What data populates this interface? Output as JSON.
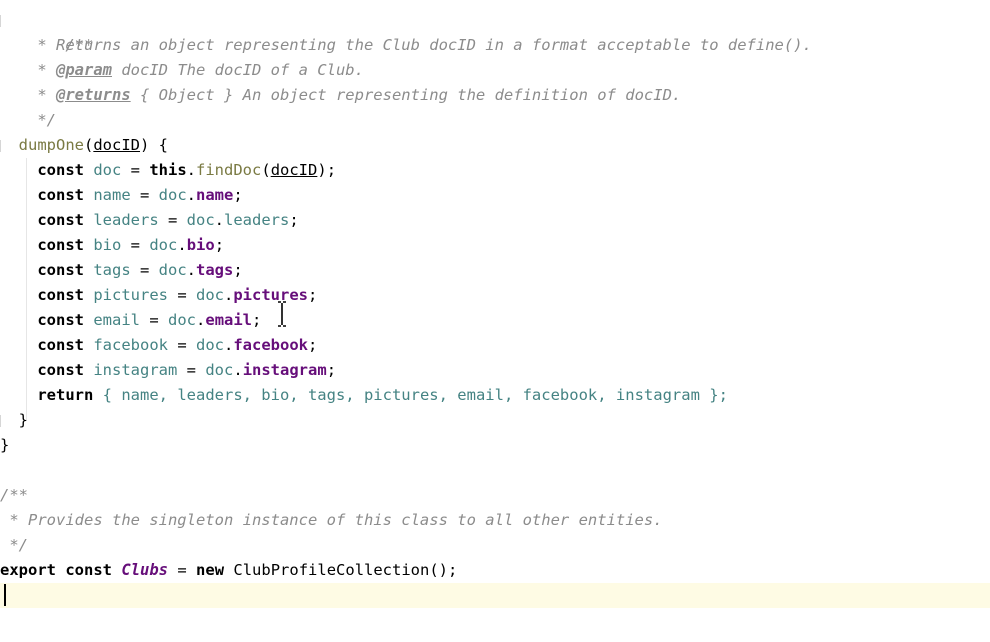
{
  "editor": {
    "language": "javascript",
    "doc_comment_1": {
      "open": "/**",
      "line1": " * Returns an object representing the Club docID in a format acceptable to define().",
      "param_tag": "@param",
      "param_text": " docID The docID of a Club.",
      "returns_tag": "@returns",
      "returns_text": " { Object } An object representing the definition of docID.",
      "close": " */"
    },
    "method": {
      "name": "dumpOne",
      "param": "docID",
      "open_brace": ") {"
    },
    "const_keyword": "const",
    "return_keyword": "return",
    "this_keyword": "this",
    "find_call": "findDoc",
    "doc_var": "doc",
    "fields": [
      "name",
      "leaders",
      "bio",
      "tags",
      "pictures",
      "email",
      "facebook",
      "instagram"
    ],
    "return_list": "{ name, leaders, bio, tags, pictures, email, facebook, instagram };",
    "close_method": "}",
    "close_class": "}",
    "doc_comment_2": {
      "open": "/**",
      "line1": " * Provides the singleton instance of this class to all other entities.",
      "close": " */"
    },
    "export_line": {
      "export": "export",
      "const": "const",
      "name": "Clubs",
      "new": "new",
      "class_name": "ClubProfileCollection",
      "call": "();"
    }
  },
  "colors": {
    "comment": "#8c8c8c",
    "keyword": "#000080",
    "property": "#660e7a",
    "variable": "#458383",
    "function": "#7a7a43",
    "current_line": "#fefbe4"
  }
}
